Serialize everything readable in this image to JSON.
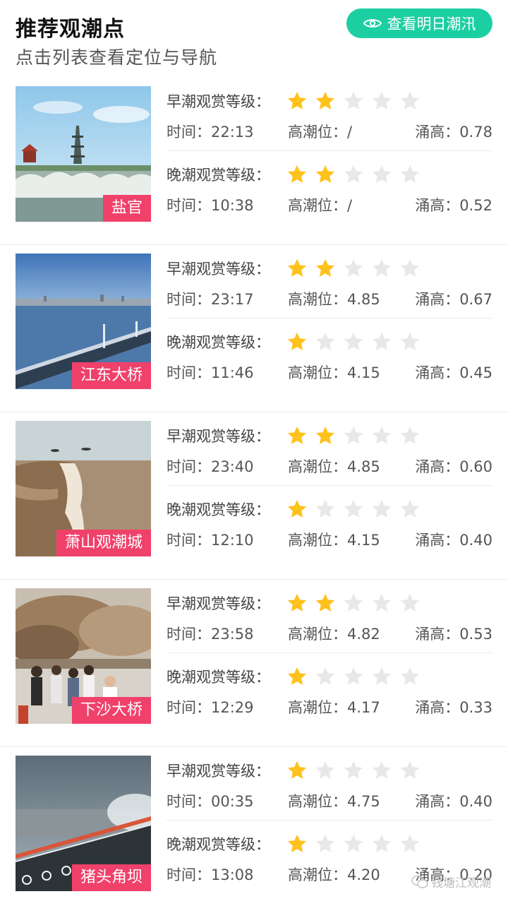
{
  "header": {
    "title": "推荐观潮点",
    "subtitle": "点击列表查看定位与导航",
    "tomorrow_button": "查看明日潮汛",
    "tomorrow_icon": "eye-icon"
  },
  "labels": {
    "morning_level": "早潮观赏等级：",
    "evening_level": "晚潮观赏等级：",
    "time": "时间：",
    "high_tide": "高潮位：",
    "surge": "涌高："
  },
  "colors": {
    "accent": "#1ccfa3",
    "tag": "#f0416b",
    "star_on": "#ffc21c",
    "star_off": "#e8e8e8"
  },
  "spots": [
    {
      "name": "盐官",
      "morning": {
        "stars": 2,
        "time": "22:13",
        "high_tide": "/",
        "surge": "0.78"
      },
      "evening": {
        "stars": 2,
        "time": "10:38",
        "high_tide": "/",
        "surge": "0.52"
      }
    },
    {
      "name": "江东大桥",
      "morning": {
        "stars": 2,
        "time": "23:17",
        "high_tide": "4.85",
        "surge": "0.67"
      },
      "evening": {
        "stars": 1,
        "time": "11:46",
        "high_tide": "4.15",
        "surge": "0.45"
      }
    },
    {
      "name": "萧山观潮城",
      "morning": {
        "stars": 2,
        "time": "23:40",
        "high_tide": "4.85",
        "surge": "0.60"
      },
      "evening": {
        "stars": 1,
        "time": "12:10",
        "high_tide": "4.15",
        "surge": "0.40"
      }
    },
    {
      "name": "下沙大桥",
      "morning": {
        "stars": 2,
        "time": "23:58",
        "high_tide": "4.82",
        "surge": "0.53"
      },
      "evening": {
        "stars": 1,
        "time": "12:29",
        "high_tide": "4.17",
        "surge": "0.33"
      }
    },
    {
      "name": "猪头角坝",
      "morning": {
        "stars": 1,
        "time": "00:35",
        "high_tide": "4.75",
        "surge": "0.40"
      },
      "evening": {
        "stars": 1,
        "time": "13:08",
        "high_tide": "4.20",
        "surge": "0.20"
      }
    }
  ],
  "watermark": "钱塘江观潮"
}
